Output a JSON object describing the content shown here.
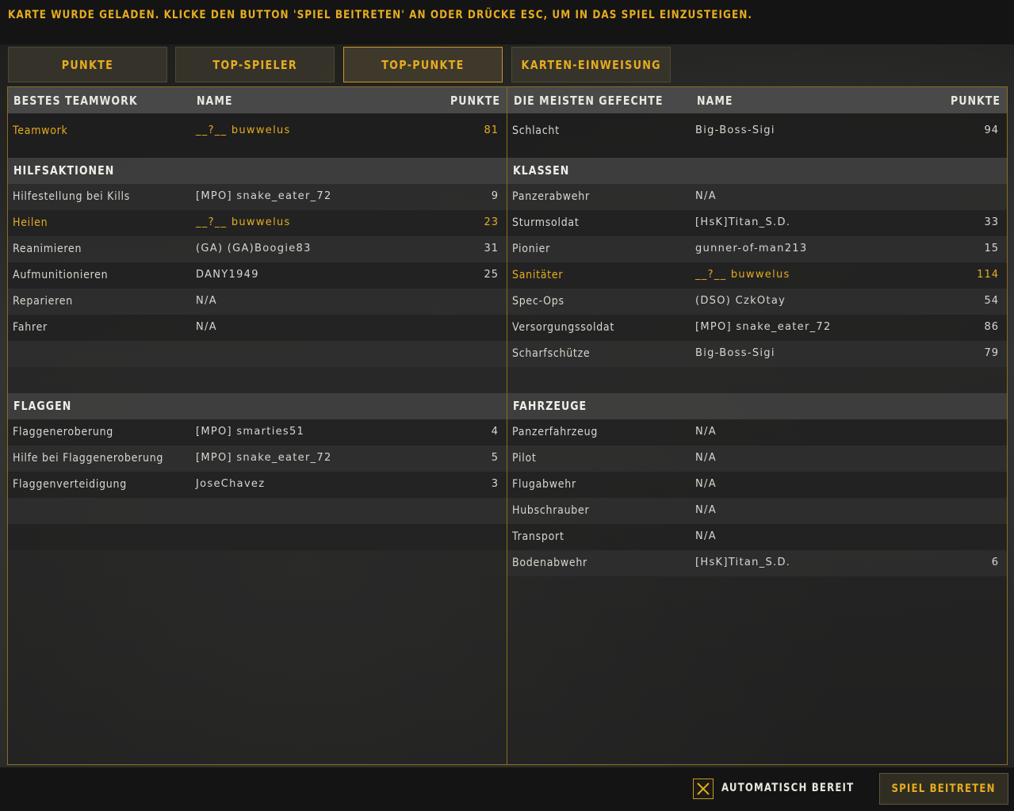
{
  "header": {
    "message": "KARTE WURDE GELADEN. KLICKE DEN BUTTON 'SPIEL BEITRETEN' AN ODER DRÜCKE ESC, UM IN DAS SPIEL EINZUSTEIGEN."
  },
  "tabs": [
    {
      "label": "PUNKTE",
      "active": false
    },
    {
      "label": "TOP-SPIELER",
      "active": false
    },
    {
      "label": "TOP-PUNKTE",
      "active": true
    },
    {
      "label": "KARTEN-EINWEISUNG",
      "active": false
    }
  ],
  "accent_color": "#e5ac1f",
  "left": {
    "header": {
      "category": "BESTES TEAMWORK",
      "name": "NAME",
      "points": "PUNKTE"
    },
    "top": {
      "category": "Teamwork",
      "name": "__?__ buwwelus",
      "points": "81",
      "highlight": true
    },
    "sections": [
      {
        "title": "HILFSAKTIONEN",
        "rows": [
          {
            "category": "Hilfestellung bei Kills",
            "name": "[MPO] snake_eater_72",
            "points": "9",
            "highlight": false
          },
          {
            "category": "Heilen",
            "name": "__?__ buwwelus",
            "points": "23",
            "highlight": true
          },
          {
            "category": "Reanimieren",
            "name": "(GA) (GA)Boogie83",
            "points": "31",
            "highlight": false
          },
          {
            "category": "Aufmunitionieren",
            "name": "DANY1949",
            "points": "25",
            "highlight": false
          },
          {
            "category": "Reparieren",
            "name": "N/A",
            "points": "",
            "highlight": false
          },
          {
            "category": "Fahrer",
            "name": "N/A",
            "points": "",
            "highlight": false
          }
        ]
      },
      {
        "title": "FLAGGEN",
        "rows": [
          {
            "category": "Flaggeneroberung",
            "name": "[MPO] smarties51",
            "points": "4",
            "highlight": false
          },
          {
            "category": "Hilfe bei Flaggeneroberung",
            "name": "[MPO] snake_eater_72",
            "points": "5",
            "highlight": false
          },
          {
            "category": "Flaggenverteidigung",
            "name": "JoseChavez",
            "points": "3",
            "highlight": false
          }
        ]
      }
    ]
  },
  "right": {
    "header": {
      "category": "DIE MEISTEN GEFECHTE",
      "name": "NAME",
      "points": "PUNKTE"
    },
    "top": {
      "category": "Schlacht",
      "name": "Big-Boss-Sigi",
      "points": "94",
      "highlight": false
    },
    "sections": [
      {
        "title": "KLASSEN",
        "rows": [
          {
            "category": "Panzerabwehr",
            "name": "N/A",
            "points": "",
            "highlight": false
          },
          {
            "category": "Sturmsoldat",
            "name": "[HsK]Titan_S.D.",
            "points": "33",
            "highlight": false
          },
          {
            "category": "Pionier",
            "name": "gunner-of-man213",
            "points": "15",
            "highlight": false
          },
          {
            "category": "Sanitäter",
            "name": "__?__ buwwelus",
            "points": "114",
            "highlight": true
          },
          {
            "category": "Spec-Ops",
            "name": "(DSO) CzkOtay",
            "points": "54",
            "highlight": false
          },
          {
            "category": "Versorgungssoldat",
            "name": "[MPO] snake_eater_72",
            "points": "86",
            "highlight": false
          },
          {
            "category": "Scharfschütze",
            "name": "Big-Boss-Sigi",
            "points": "79",
            "highlight": false
          }
        ]
      },
      {
        "title": "FAHRZEUGE",
        "rows": [
          {
            "category": "Panzerfahrzeug",
            "name": "N/A",
            "points": "",
            "highlight": false
          },
          {
            "category": "Pilot",
            "name": "N/A",
            "points": "",
            "highlight": false
          },
          {
            "category": "Flugabwehr",
            "name": "N/A",
            "points": "",
            "highlight": false
          },
          {
            "category": "Hubschrauber",
            "name": "N/A",
            "points": "",
            "highlight": false
          },
          {
            "category": "Transport",
            "name": "N/A",
            "points": "",
            "highlight": false
          },
          {
            "category": "Bodenabwehr",
            "name": "[HsK]Titan_S.D.",
            "points": "6",
            "highlight": false
          }
        ]
      }
    ]
  },
  "footer": {
    "auto_ready_label": "AUTOMATISCH BEREIT",
    "auto_ready_checked": true,
    "join_button": "SPIEL BEITRETEN"
  }
}
